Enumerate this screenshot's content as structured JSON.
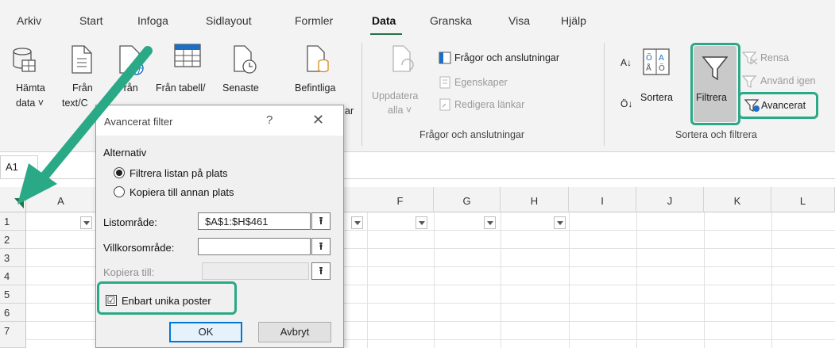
{
  "ribbon_tabs": [
    "Arkiv",
    "Start",
    "Infoga",
    "Sidlayout",
    "Formler",
    "Data",
    "Granska",
    "Visa",
    "Hjälp"
  ],
  "ribbon": {
    "hamta_line1": "Hämta",
    "hamta_line2": "data ˅",
    "fran_line1": "Från",
    "fran_line2": "text/C",
    "fran_webb": "Från",
    "fran_tabell": "Från tabell/",
    "senaste": "Senaste",
    "befintliga": "Befintliga",
    "befintliga_tail": "ar",
    "uppdatera_line1": "Uppdatera",
    "uppdatera_line2": "alla ˅",
    "fragor_anslutningar": "Frågor och anslutningar",
    "egenskaper": "Egenskaper",
    "redigera_lankar": "Redigera länkar",
    "group_fragor": "Frågor och anslutningar",
    "sortera": "Sortera",
    "filtrera": "Filtrera",
    "rensa": "Rensa",
    "anvand_igen": "Använd igen",
    "avancerat": "Avancerat",
    "group_sortera": "Sortera och filtrera",
    "sort_az": "A↓",
    "sort_za": "Ö↓"
  },
  "namebox": "A1",
  "columns": [
    "A",
    "F",
    "G",
    "H",
    "I",
    "J",
    "K",
    "L"
  ],
  "rows": [
    "1",
    "2",
    "3",
    "4",
    "5",
    "6",
    "7"
  ],
  "dialog": {
    "title": "Avancerat filter",
    "help": "?",
    "close": "✕",
    "section": "Alternativ",
    "option_filter": "Filtrera listan på plats",
    "option_copy": "Kopiera till annan plats",
    "list_label": "Listområde:",
    "list_value": "$A$1:$H$461",
    "criteria_label": "Villkorsområde:",
    "criteria_value": "",
    "copy_label": "Kopiera till:",
    "copy_value": "",
    "unique_label": "Enbart unika poster",
    "unique_checked": "☑",
    "ok": "OK",
    "cancel": "Avbryt",
    "picker_glyph": "⭱"
  },
  "colors": {
    "highlight": "#2aa987",
    "excel_green": "#217346",
    "accent": "#0078d7"
  }
}
